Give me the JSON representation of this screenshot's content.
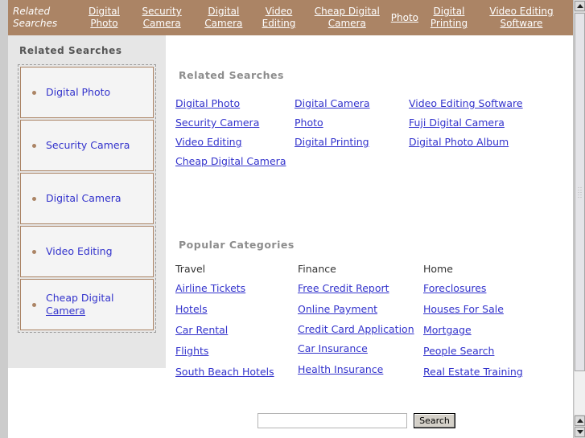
{
  "banner": {
    "title": "Related Searches",
    "links": [
      "Digital Photo",
      "Security Camera",
      "Digital Camera",
      "Video Editing",
      "Cheap Digital Camera",
      "Photo",
      "Digital Printing",
      "Video Editing Software"
    ]
  },
  "sidebar": {
    "heading": "Related Searches",
    "items": [
      {
        "label": "Digital Photo",
        "underlined_part": ""
      },
      {
        "label": "Security Camera",
        "underlined_part": ""
      },
      {
        "label": "Digital Camera",
        "underlined_part": ""
      },
      {
        "label": "Video Editing",
        "underlined_part": ""
      },
      {
        "label": "Cheap Digital ",
        "underlined_part": "Camera"
      }
    ]
  },
  "related_searches": {
    "heading": "Related Searches",
    "columns": [
      [
        "Digital Photo",
        "Security Camera",
        "Video Editing",
        "Cheap Digital Camera"
      ],
      [
        "Digital Camera",
        "Photo",
        "Digital Printing"
      ],
      [
        "Video Editing Software",
        "Fuji Digital Camera",
        "Digital Photo Album"
      ]
    ]
  },
  "popular_categories": {
    "heading": "Popular Categories",
    "columns": [
      {
        "label": "Travel",
        "links": [
          "Airline Tickets",
          "Hotels",
          "Car Rental",
          "Flights",
          "South Beach Hotels"
        ]
      },
      {
        "label": "Finance",
        "links": [
          "Free Credit Report",
          "Online Payment",
          "Credit Card Application",
          "Car Insurance",
          "Health Insurance"
        ]
      },
      {
        "label": "Home",
        "links": [
          "Foreclosures",
          "Houses For Sale",
          "Mortgage",
          "People Search",
          "Real Estate Training"
        ]
      }
    ]
  },
  "search": {
    "value": "",
    "placeholder": "",
    "button_label": "Search"
  },
  "colors": {
    "banner_background": "#ab8465",
    "link_blue": "#3333cc",
    "sidebar_background": "#e6e6e6",
    "heading_gray": "#8d8d8d"
  }
}
